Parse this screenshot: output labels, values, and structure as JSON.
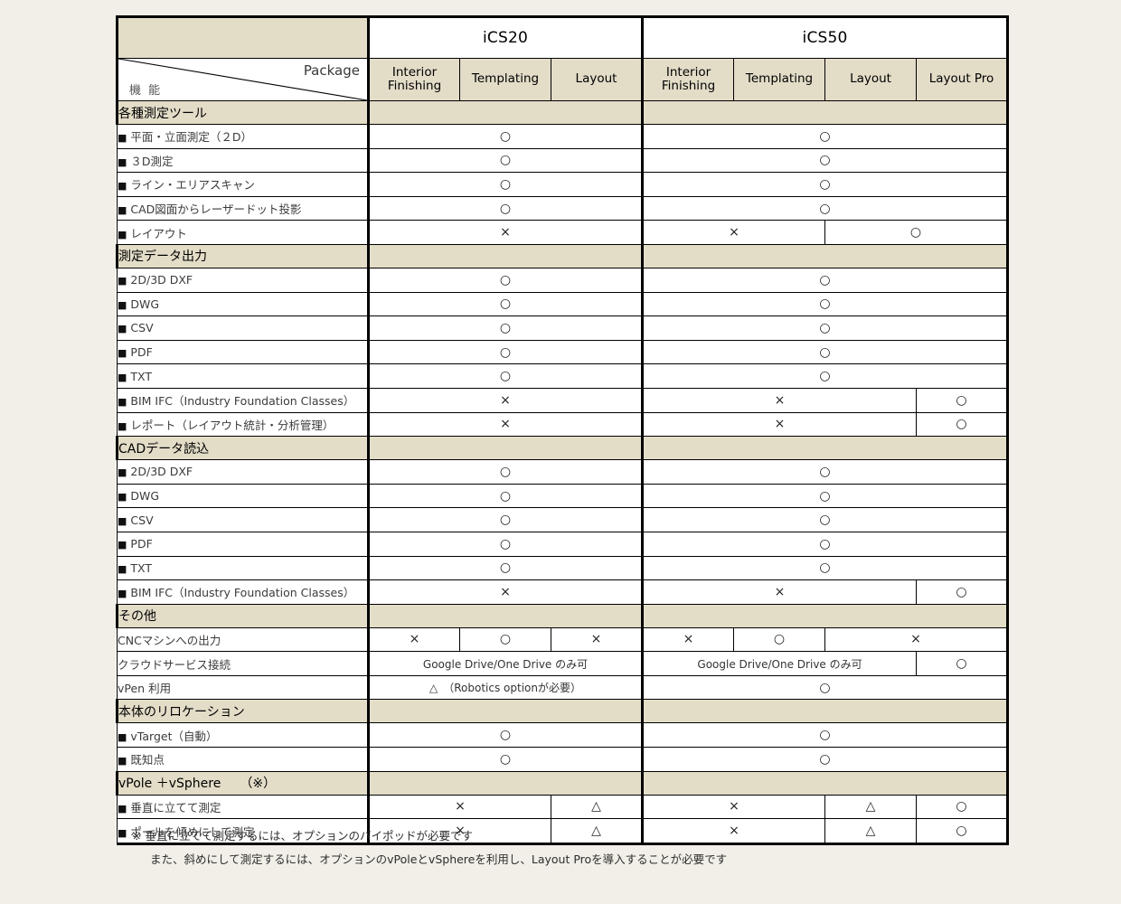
{
  "header": {
    "corner": {
      "package_label": "Package",
      "feature_label": "機 能"
    },
    "models": [
      {
        "name": "iCS20",
        "packages": [
          "Interior\nFinishing",
          "Templating",
          "Layout"
        ]
      },
      {
        "name": "iCS50",
        "packages": [
          "Interior\nFinishing",
          "Templating",
          "Layout",
          "Layout Pro"
        ]
      }
    ],
    "package_labels": {
      "ics20": [
        "Interior Finishing",
        "Templating",
        "Layout"
      ],
      "ics50": [
        "Interior Finishing",
        "Templating",
        "Layout",
        "Layout Pro"
      ]
    }
  },
  "marks": {
    "yes": "○",
    "no": "×",
    "partial": "△"
  },
  "colors": {
    "band": "#e3ddc8",
    "page": "#f1efe7",
    "border": "#000000",
    "text": "#3b3b3b"
  },
  "sections": [
    {
      "title": "各種測定ツール",
      "rows": [
        {
          "label": "平面・立面測定（２D）",
          "bullet": true,
          "ics20": [
            {
              "span": 3,
              "text": "○"
            }
          ],
          "ics50": [
            {
              "span": 4,
              "text": "○"
            }
          ]
        },
        {
          "label": "３D測定",
          "bullet": true,
          "ics20": [
            {
              "span": 3,
              "text": "○"
            }
          ],
          "ics50": [
            {
              "span": 4,
              "text": "○"
            }
          ]
        },
        {
          "label": "ライン・エリアスキャン",
          "bullet": true,
          "ics20": [
            {
              "span": 3,
              "text": "○"
            }
          ],
          "ics50": [
            {
              "span": 4,
              "text": "○"
            }
          ]
        },
        {
          "label": "CAD図面からレーザードット投影",
          "bullet": true,
          "ics20": [
            {
              "span": 3,
              "text": "○"
            }
          ],
          "ics50": [
            {
              "span": 4,
              "text": "○"
            }
          ]
        },
        {
          "label": "レイアウト",
          "bullet": true,
          "ics20": [
            {
              "span": 3,
              "text": "×"
            }
          ],
          "ics50": [
            {
              "span": 2,
              "text": "×"
            },
            {
              "span": 2,
              "text": "○"
            }
          ]
        }
      ]
    },
    {
      "title": "測定データ出力",
      "rows": [
        {
          "label": "2D/3D DXF",
          "bullet": true,
          "ics20": [
            {
              "span": 3,
              "text": "○"
            }
          ],
          "ics50": [
            {
              "span": 4,
              "text": "○"
            }
          ]
        },
        {
          "label": "DWG",
          "bullet": true,
          "ics20": [
            {
              "span": 3,
              "text": "○"
            }
          ],
          "ics50": [
            {
              "span": 4,
              "text": "○"
            }
          ]
        },
        {
          "label": "CSV",
          "bullet": true,
          "ics20": [
            {
              "span": 3,
              "text": "○"
            }
          ],
          "ics50": [
            {
              "span": 4,
              "text": "○"
            }
          ]
        },
        {
          "label": "PDF",
          "bullet": true,
          "ics20": [
            {
              "span": 3,
              "text": "○"
            }
          ],
          "ics50": [
            {
              "span": 4,
              "text": "○"
            }
          ]
        },
        {
          "label": "TXT",
          "bullet": true,
          "ics20": [
            {
              "span": 3,
              "text": "○"
            }
          ],
          "ics50": [
            {
              "span": 4,
              "text": "○"
            }
          ]
        },
        {
          "label": "BIM IFC（Industry Foundation Classes）",
          "bullet": true,
          "ics20": [
            {
              "span": 3,
              "text": "×"
            }
          ],
          "ics50": [
            {
              "span": 3,
              "text": "×"
            },
            {
              "span": 1,
              "text": "○"
            }
          ]
        },
        {
          "label": "レポート（レイアウト統計・分析管理）",
          "bullet": true,
          "ics20": [
            {
              "span": 3,
              "text": "×"
            }
          ],
          "ics50": [
            {
              "span": 3,
              "text": "×"
            },
            {
              "span": 1,
              "text": "○"
            }
          ]
        }
      ]
    },
    {
      "title": "CADデータ読込",
      "rows": [
        {
          "label": "2D/3D DXF",
          "bullet": true,
          "ics20": [
            {
              "span": 3,
              "text": "○"
            }
          ],
          "ics50": [
            {
              "span": 4,
              "text": "○"
            }
          ]
        },
        {
          "label": "DWG",
          "bullet": true,
          "ics20": [
            {
              "span": 3,
              "text": "○"
            }
          ],
          "ics50": [
            {
              "span": 4,
              "text": "○"
            }
          ]
        },
        {
          "label": "CSV",
          "bullet": true,
          "ics20": [
            {
              "span": 3,
              "text": "○"
            }
          ],
          "ics50": [
            {
              "span": 4,
              "text": "○"
            }
          ]
        },
        {
          "label": "PDF",
          "bullet": true,
          "ics20": [
            {
              "span": 3,
              "text": "○"
            }
          ],
          "ics50": [
            {
              "span": 4,
              "text": "○"
            }
          ]
        },
        {
          "label": "TXT",
          "bullet": true,
          "ics20": [
            {
              "span": 3,
              "text": "○"
            }
          ],
          "ics50": [
            {
              "span": 4,
              "text": "○"
            }
          ]
        },
        {
          "label": "BIM IFC（Industry Foundation Classes）",
          "bullet": true,
          "ics20": [
            {
              "span": 3,
              "text": "×"
            }
          ],
          "ics50": [
            {
              "span": 3,
              "text": "×"
            },
            {
              "span": 1,
              "text": "○"
            }
          ]
        }
      ]
    },
    {
      "title": "その他",
      "rows": [
        {
          "label": "CNCマシンへの出力",
          "bullet": false,
          "ics20": [
            {
              "span": 1,
              "text": "×"
            },
            {
              "span": 1,
              "text": "○"
            },
            {
              "span": 1,
              "text": "×"
            }
          ],
          "ics50": [
            {
              "span": 1,
              "text": "×"
            },
            {
              "span": 1,
              "text": "○"
            },
            {
              "span": 2,
              "text": "×"
            }
          ]
        },
        {
          "label": "クラウドサービス接続",
          "bullet": false,
          "ics20": [
            {
              "span": 3,
              "text": "Google Drive/One Drive のみ可",
              "note": true
            }
          ],
          "ics50": [
            {
              "span": 3,
              "text": "Google Drive/One Drive のみ可",
              "note": true
            },
            {
              "span": 1,
              "text": "○"
            }
          ]
        },
        {
          "label": "vPen 利用",
          "bullet": false,
          "ics20": [
            {
              "span": 3,
              "text": "△　（Robotics optionが必要）",
              "note": true
            }
          ],
          "ics50": [
            {
              "span": 4,
              "text": "○"
            }
          ]
        }
      ]
    },
    {
      "title": "本体のリロケーション",
      "rows": [
        {
          "label": "vTarget（自動）",
          "bullet": true,
          "ics20": [
            {
              "span": 3,
              "text": "○"
            }
          ],
          "ics50": [
            {
              "span": 4,
              "text": "○"
            }
          ]
        },
        {
          "label": "既知点",
          "bullet": true,
          "ics20": [
            {
              "span": 3,
              "text": "○"
            }
          ],
          "ics50": [
            {
              "span": 4,
              "text": "○"
            }
          ]
        }
      ]
    },
    {
      "title": "vPole ＋vSphere　　（※）",
      "rows": [
        {
          "label": "垂直に立てて測定",
          "bullet": true,
          "ics20": [
            {
              "span": 2,
              "text": "×"
            },
            {
              "span": 1,
              "text": "△"
            }
          ],
          "ics50": [
            {
              "span": 2,
              "text": "×"
            },
            {
              "span": 1,
              "text": "△"
            },
            {
              "span": 1,
              "text": "○"
            }
          ]
        },
        {
          "label": "ポールを傾めにして測定",
          "bullet": true,
          "ics20": [
            {
              "span": 2,
              "text": "×"
            },
            {
              "span": 1,
              "text": "△"
            }
          ],
          "ics50": [
            {
              "span": 2,
              "text": "×"
            },
            {
              "span": 1,
              "text": "△"
            },
            {
              "span": 1,
              "text": "○"
            }
          ]
        }
      ]
    }
  ],
  "footnotes": [
    "※ 垂直に立てて測定するには、オプションのバイポッドが必要です",
    "また、斜めにして測定するには、オプションのvPoleとvSphereを利用し、Layout Proを導入することが必要です"
  ]
}
